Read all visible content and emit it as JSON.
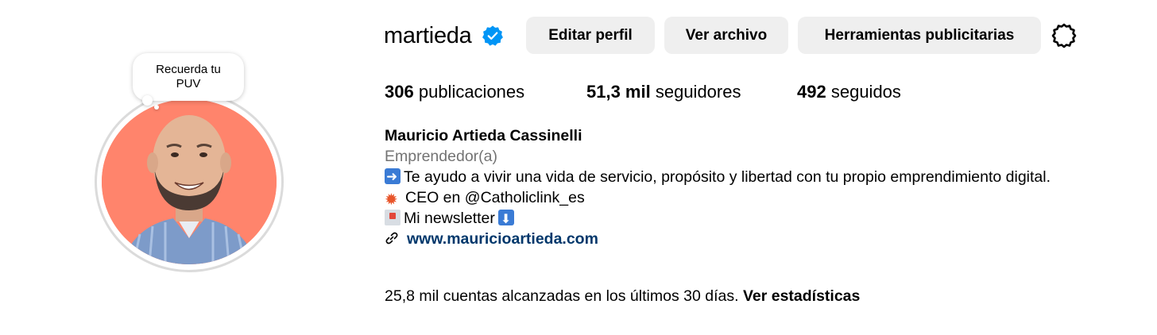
{
  "profile": {
    "username": "martieda",
    "verified": true,
    "note": "Recuerda tu PUV",
    "avatar_bg_color": "#ff846c"
  },
  "buttons": {
    "edit_profile": "Editar perfil",
    "view_archive": "Ver archivo",
    "ad_tools": "Herramientas publicitarias"
  },
  "stats": {
    "posts": {
      "count": "306",
      "label": "publicaciones"
    },
    "followers": {
      "count": "51,3 mil",
      "label": "seguidores"
    },
    "following": {
      "count": "492",
      "label": "seguidos"
    }
  },
  "bio": {
    "full_name": "Mauricio Artieda Cassinelli",
    "category": "Emprendedor(a)",
    "line1": "Te ayudo a vivir una vida de servicio, propósito y libertad con tu propio emprendimiento digital.",
    "line2": "CEO en @Catholiclink_es",
    "line3": "Mi newsletter",
    "website": "www.mauricioartieda.com"
  },
  "insights": {
    "text": "25,8 mil cuentas alcanzadas en los últimos 30 días.",
    "link": "Ver estadísticas"
  },
  "icons": [
    "verified-badge-icon",
    "gear-icon",
    "link-icon",
    "arrow-right-emoji",
    "collision-emoji",
    "envelope-emoji",
    "down-arrow-emoji"
  ],
  "colors": {
    "button_bg": "#efefef",
    "verified_blue": "#0095f6",
    "link_blue": "#00376b",
    "secondary_text": "#737373"
  }
}
